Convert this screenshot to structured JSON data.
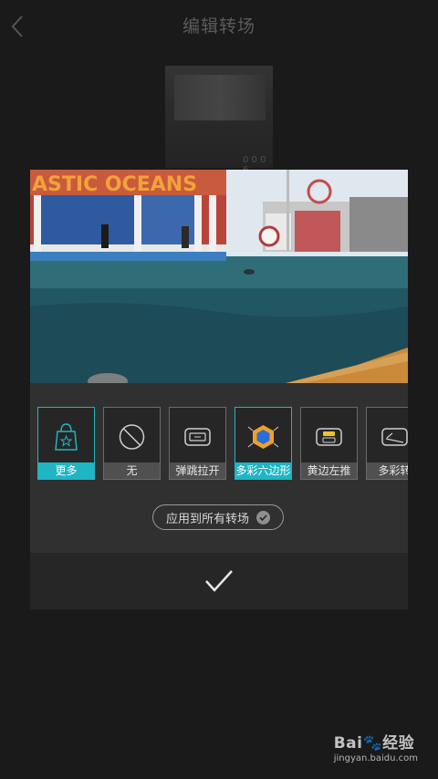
{
  "header": {
    "title": "编辑转场"
  },
  "background_thumb": {
    "label": "0 0 0 6"
  },
  "preview": {
    "sign_text": "ASTIC OCEANS"
  },
  "effects": [
    {
      "label": "更多",
      "icon": "shopping-bag-star-icon",
      "active": true
    },
    {
      "label": "无",
      "icon": "none-slash-icon",
      "active": false
    },
    {
      "label": "弹跳拉开",
      "icon": "bounce-open-icon",
      "active": false
    },
    {
      "label": "多彩六边形",
      "icon": "colorful-hexagon-icon",
      "active": true
    },
    {
      "label": "黄边左推",
      "icon": "yellow-edge-push-left-icon",
      "active": false
    },
    {
      "label": "多彩转",
      "icon": "colorful-turn-icon",
      "active": false
    }
  ],
  "apply_all": {
    "label": "应用到所有转场"
  },
  "watermark": {
    "logo_text": "Bai",
    "logo_suffix": "经验",
    "url": "jingyan.baidu.com"
  },
  "colors": {
    "accent": "#1fb5c4",
    "background": "#1a1a1a",
    "panel": "#262626"
  }
}
